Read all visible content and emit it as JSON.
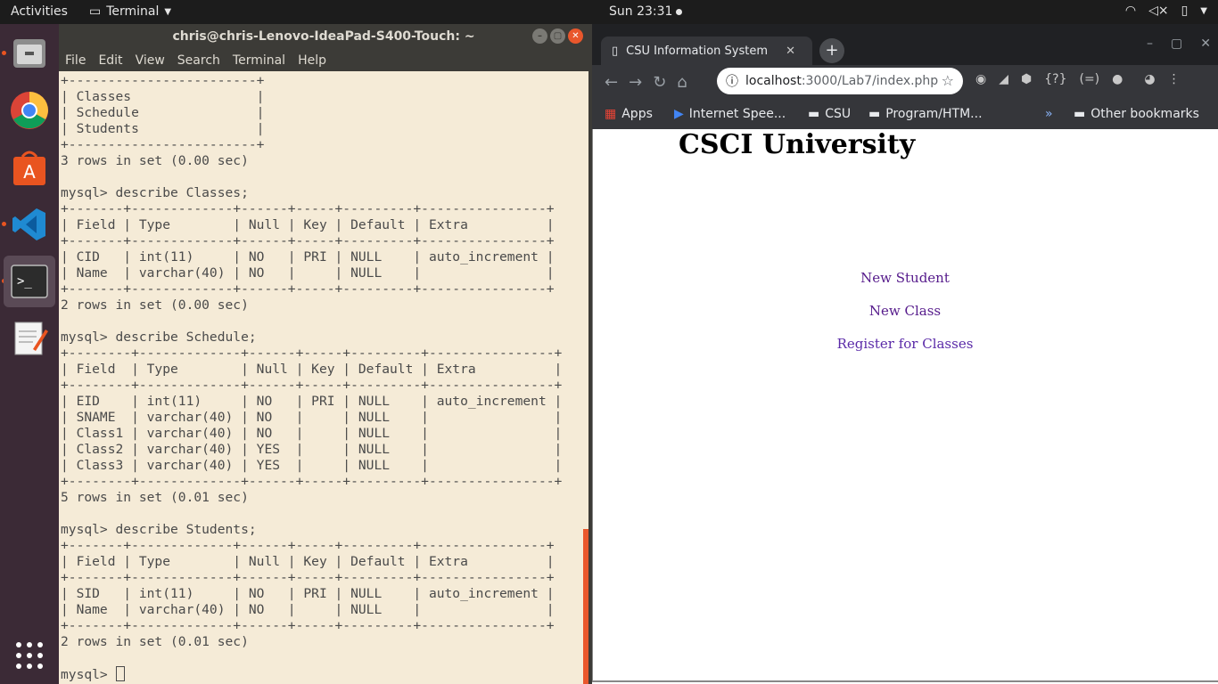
{
  "topbar": {
    "activities": "Activities",
    "app_name": "Terminal",
    "clock": "Sun 23:31"
  },
  "dock": {
    "items": [
      "files-icon",
      "chrome-icon",
      "software-center-icon",
      "vscode-icon",
      "terminal-icon",
      "text-editor-icon",
      "show-apps-icon"
    ]
  },
  "terminal": {
    "title": "chris@chris-Lenovo-IdeaPad-S400-Touch: ~",
    "menu": [
      "File",
      "Edit",
      "View",
      "Search",
      "Terminal",
      "Help"
    ],
    "output": "+------------------------+\n| Classes                |\n| Schedule               |\n| Students               |\n+------------------------+\n3 rows in set (0.00 sec)\n\nmysql> describe Classes;\n+-------+-------------+------+-----+---------+----------------+\n| Field | Type        | Null | Key | Default | Extra          |\n+-------+-------------+------+-----+---------+----------------+\n| CID   | int(11)     | NO   | PRI | NULL    | auto_increment |\n| Name  | varchar(40) | NO   |     | NULL    |                |\n+-------+-------------+------+-----+---------+----------------+\n2 rows in set (0.00 sec)\n\nmysql> describe Schedule;\n+--------+-------------+------+-----+---------+----------------+\n| Field  | Type        | Null | Key | Default | Extra          |\n+--------+-------------+------+-----+---------+----------------+\n| EID    | int(11)     | NO   | PRI | NULL    | auto_increment |\n| SNAME  | varchar(40) | NO   |     | NULL    |                |\n| Class1 | varchar(40) | NO   |     | NULL    |                |\n| Class2 | varchar(40) | YES  |     | NULL    |                |\n| Class3 | varchar(40) | YES  |     | NULL    |                |\n+--------+-------------+------+-----+---------+----------------+\n5 rows in set (0.01 sec)\n\nmysql> describe Students;\n+-------+-------------+------+-----+---------+----------------+\n| Field | Type        | Null | Key | Default | Extra          |\n+-------+-------------+------+-----+---------+----------------+\n| SID   | int(11)     | NO   | PRI | NULL    | auto_increment |\n| Name  | varchar(40) | NO   |     | NULL    |                |\n+-------+-------------+------+-----+---------+----------------+\n2 rows in set (0.01 sec)\n\n",
    "prompt": "mysql> "
  },
  "browser": {
    "tab_title": "CSU Information System",
    "url_host": "localhost",
    "url_path": ":3000/Lab7/index.php",
    "bookmarks": {
      "apps": "Apps",
      "b1": "Internet Spee...",
      "b2": "CSU",
      "b3": "Program/HTM...",
      "more": "»",
      "other": "Other bookmarks"
    },
    "page": {
      "heading": "CSCI University",
      "links": [
        "New Student",
        "New Class",
        "Register for Classes"
      ]
    }
  },
  "colors": {
    "terminal_bg": "#f5ebd7",
    "accent": "#e95420",
    "link_visited": "#551a8b"
  }
}
